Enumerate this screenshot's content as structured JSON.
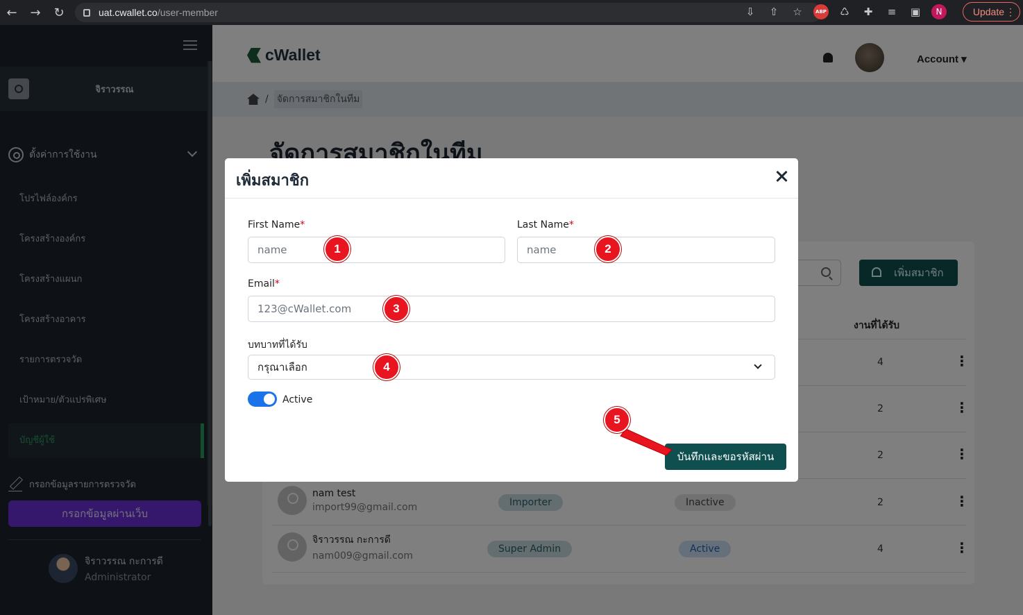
{
  "browser": {
    "url_host": "uat.cwallet.co",
    "url_path": "/user-member",
    "profile_initial": "N",
    "update_label": "Update",
    "abp_label": "ABP"
  },
  "sidebar": {
    "username": "จิราวรรณ",
    "settings_label": "ตั้งค่าการใช้งาน",
    "items": [
      {
        "label": "โปรไฟล์องค์กร"
      },
      {
        "label": "โครงสร้างองค์กร"
      },
      {
        "label": "โครงสร้างแผนก"
      },
      {
        "label": "โครงสร้างอาคาร"
      },
      {
        "label": "รายการตรวจวัด"
      },
      {
        "label": "เป้าหมาย/ตัวแปรพิเศษ"
      },
      {
        "label": "บัญชีผู้ใช้"
      }
    ],
    "checklist_label": "กรอกข้อมูลรายการตรวจวัด",
    "web_button_label": "กรอกข้อมูลผ่านเว็บ",
    "admin_name": "จิราวรรณ กะการดี",
    "admin_role": "Administrator"
  },
  "header": {
    "logo_text": "cWallet",
    "account_label": "Account ▾"
  },
  "breadcrumb": {
    "separator": "/",
    "current": "จัดการสมาชิกในทีม"
  },
  "page": {
    "title": "จัดการสมาชิกในทีม",
    "add_member_label": "เพิ่มสมาชิก",
    "tasks_header": "งานที่ได้รับ",
    "rows": [
      {
        "tasks": "4"
      },
      {
        "tasks": "2"
      },
      {
        "tasks": "2"
      },
      {
        "name": "nam test",
        "email": "import99@gmail.com",
        "role": "Importer",
        "status": "Inactive",
        "tasks": "2"
      },
      {
        "name": "จิราวรรณ กะการดี",
        "email": "nam009@gmail.com",
        "role": "Super Admin",
        "status": "Active",
        "tasks": "4"
      }
    ]
  },
  "modal": {
    "title": "เพิ่มสมาชิก",
    "first_name_label": "First Name",
    "first_name_placeholder": "name",
    "last_name_label": "Last Name",
    "last_name_placeholder": "name",
    "email_label": "Email",
    "email_placeholder": "123@cWallet.com",
    "required_mark": "*",
    "role_label": "บทบาทที่ได้รับ",
    "role_selected": "กรุณาเลือก",
    "active_label": "Active",
    "active_on": true,
    "save_label": "บันทึกและขอรหัสผ่าน"
  },
  "steps": [
    "1",
    "2",
    "3",
    "4",
    "5"
  ],
  "colors": {
    "brand": "#104f4f",
    "sidebar_bg": "#1c232b",
    "accent_active": "#2e9b5e",
    "purple_button": "#6b2fd6",
    "step_marker": "#e8141f",
    "toggle": "#1a73e8"
  }
}
